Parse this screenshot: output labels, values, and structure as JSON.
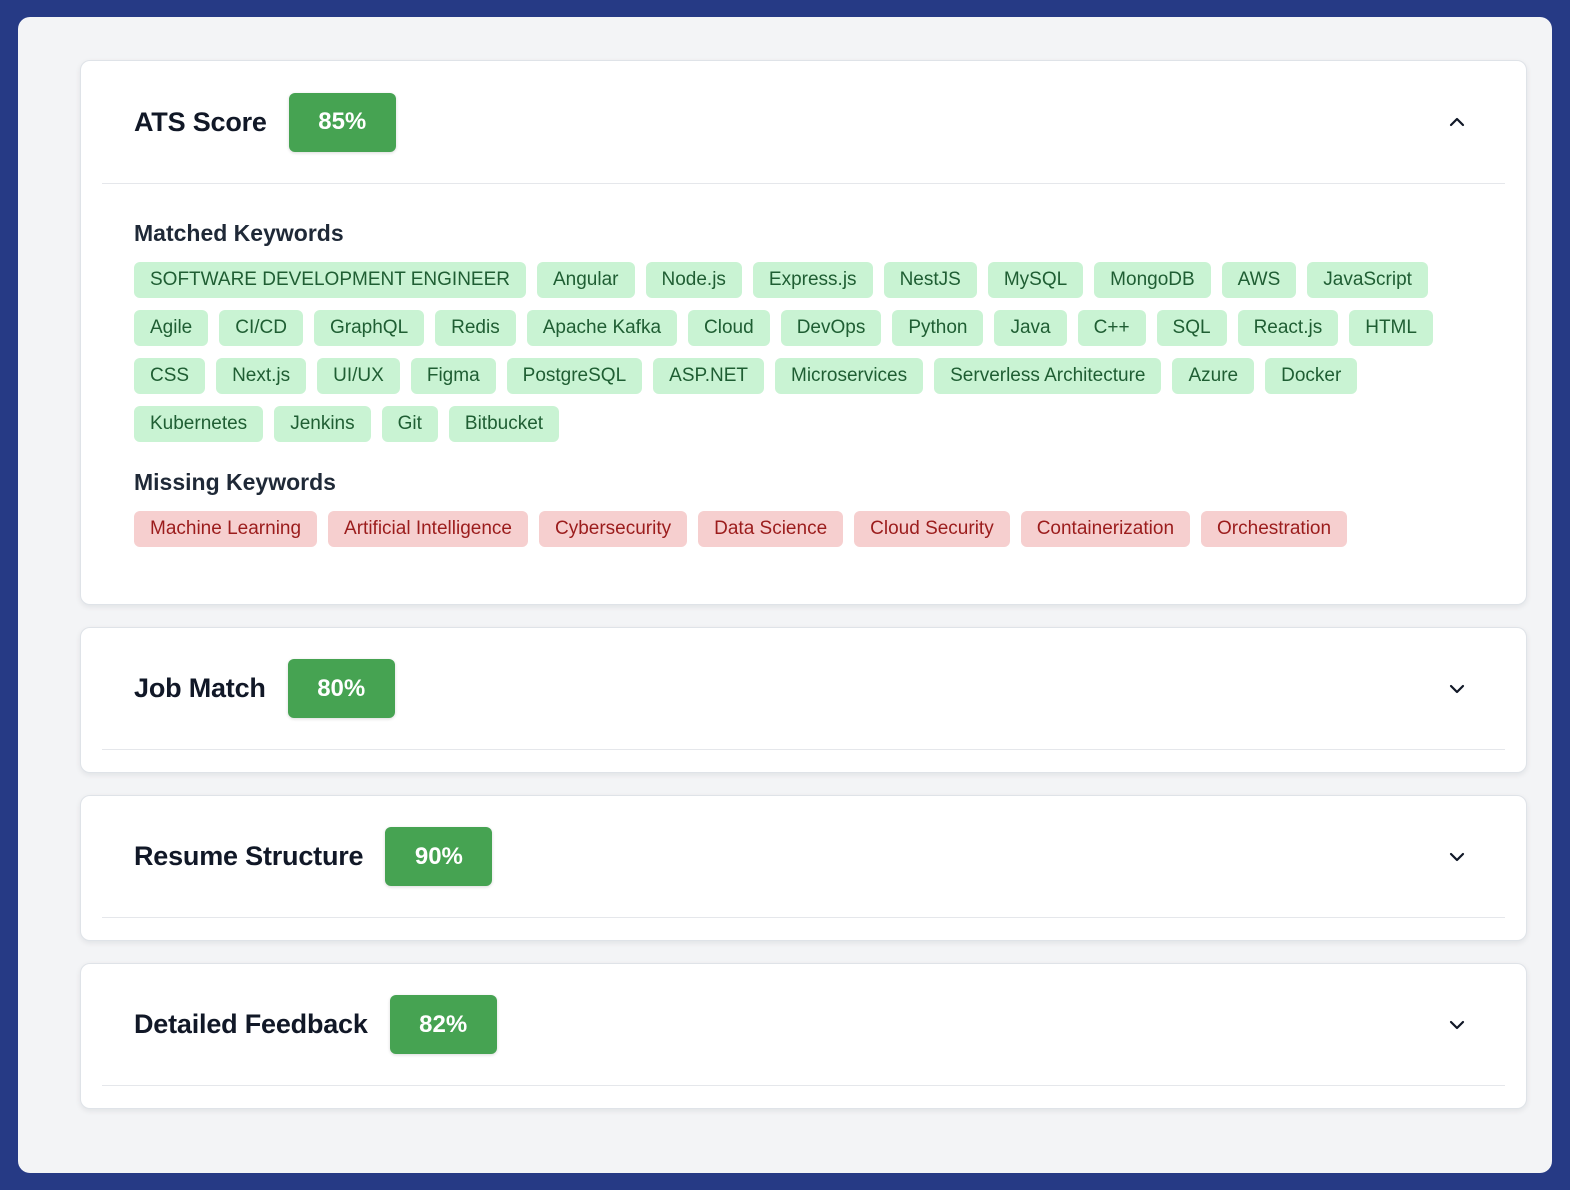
{
  "colors": {
    "background": "#263a85",
    "panel": "#f3f4f6",
    "score_badge": "#46a352",
    "matched_bg": "#c9f3d3",
    "matched_text": "#1f5e33",
    "missing_bg": "#f6cfcf",
    "missing_text": "#9b1c1c"
  },
  "sections": [
    {
      "title": "ATS Score",
      "score": "85%",
      "expanded": true,
      "chevron_icon": "chevron-up-icon",
      "matched_label": "Matched Keywords",
      "matched": [
        "SOFTWARE DEVELOPMENT ENGINEER",
        "Angular",
        "Node.js",
        "Express.js",
        "NestJS",
        "MySQL",
        "MongoDB",
        "AWS",
        "JavaScript",
        "Agile",
        "CI/CD",
        "GraphQL",
        "Redis",
        "Apache Kafka",
        "Cloud",
        "DevOps",
        "Python",
        "Java",
        "C++",
        "SQL",
        "React.js",
        "HTML",
        "CSS",
        "Next.js",
        "UI/UX",
        "Figma",
        "PostgreSQL",
        "ASP.NET",
        "Microservices",
        "Serverless Architecture",
        "Azure",
        "Docker",
        "Kubernetes",
        "Jenkins",
        "Git",
        "Bitbucket"
      ],
      "missing_label": "Missing Keywords",
      "missing": [
        "Machine Learning",
        "Artificial Intelligence",
        "Cybersecurity",
        "Data Science",
        "Cloud Security",
        "Containerization",
        "Orchestration"
      ]
    },
    {
      "title": "Job Match",
      "score": "80%",
      "expanded": false,
      "chevron_icon": "chevron-down-icon"
    },
    {
      "title": "Resume Structure",
      "score": "90%",
      "expanded": false,
      "chevron_icon": "chevron-down-icon"
    },
    {
      "title": "Detailed Feedback",
      "score": "82%",
      "expanded": false,
      "chevron_icon": "chevron-down-icon"
    }
  ]
}
